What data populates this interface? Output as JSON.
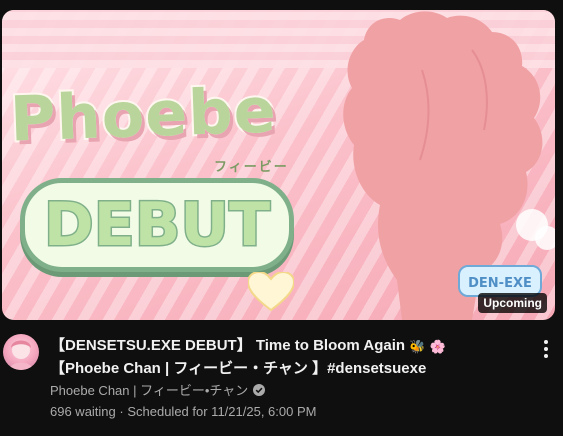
{
  "thumbnail": {
    "logo_text": "Phoebe",
    "logo_kana": "フィービー",
    "debut_text": "DEBUT",
    "badge": "Upcoming",
    "brand_mark": "DEN-EXE"
  },
  "video": {
    "title_part1": "【DENSETSU.EXE DEBUT】 Time to Bloom Again ",
    "title_emoji1": "🐝",
    "title_emoji2": "🌸",
    "title_part2": " 【Phoebe Chan | フィービー・チャン 】#densetsuexe",
    "channel": "Phoebe Chan | フィービー•チャン",
    "waiting": "696 waiting",
    "separator": " · ",
    "scheduled": "Scheduled for 11/21/25, 6:00 PM"
  },
  "icons": {
    "menu": "more-vert-icon",
    "verified": "verified-check-icon"
  },
  "colors": {
    "background": "#0f0f0f",
    "primary_text": "#f1f1f1",
    "secondary_text": "#aaaaaa",
    "badge_bg": "#000000"
  }
}
